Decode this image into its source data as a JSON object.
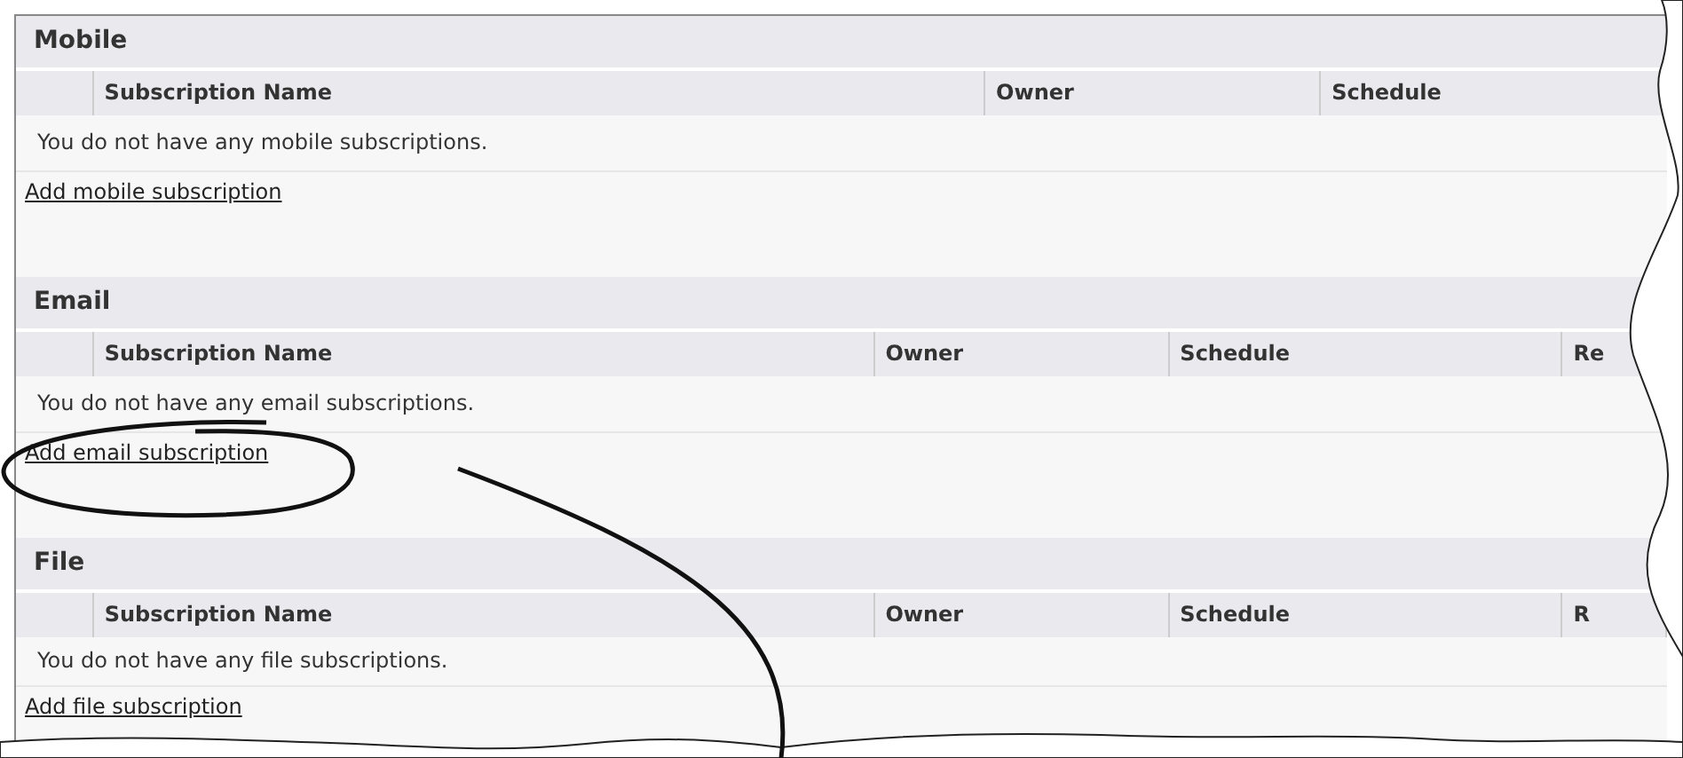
{
  "sections": [
    {
      "title": "Mobile",
      "columns": [
        "Subscription Name",
        "Owner",
        "Schedule"
      ],
      "message": "You do not have any mobile subscriptions.",
      "link": "Add mobile subscription"
    },
    {
      "title": "Email",
      "columns": [
        "Subscription Name",
        "Owner",
        "Schedule",
        "Re"
      ],
      "message": "You do not have any email subscriptions.",
      "link": "Add email subscription"
    },
    {
      "title": "File",
      "columns": [
        "Subscription Name",
        "Owner",
        "Schedule",
        "R"
      ],
      "message": "You do not have any file subscriptions.",
      "link": "Add file subscription"
    }
  ]
}
